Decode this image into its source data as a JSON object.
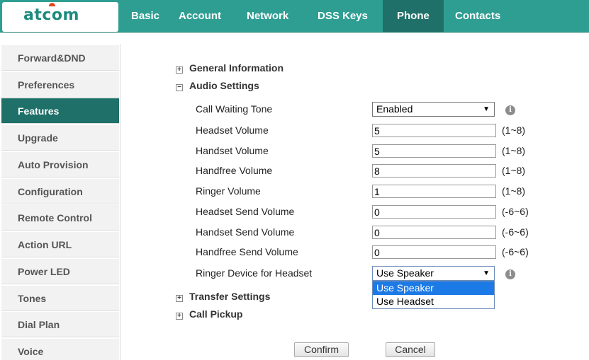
{
  "brand": {
    "logo": "atcom"
  },
  "nav": {
    "tabs": [
      "Basic",
      "Account",
      "Network",
      "DSS Keys",
      "Phone",
      "Contacts"
    ],
    "active": "Phone"
  },
  "sidebar": {
    "items": [
      "Forward&DND",
      "Preferences",
      "Features",
      "Upgrade",
      "Auto Provision",
      "Configuration",
      "Remote Control",
      "Action URL",
      "Power LED",
      "Tones",
      "Dial Plan",
      "Voice"
    ],
    "active": "Features"
  },
  "sections": {
    "general": {
      "sign": "+",
      "label": "General Information"
    },
    "audio": {
      "sign": "−",
      "label": "Audio Settings"
    },
    "transfer": {
      "sign": "+",
      "label": "Transfer Settings"
    },
    "pickup": {
      "sign": "+",
      "label": "Call Pickup"
    }
  },
  "audio": {
    "call_waiting_tone": {
      "label": "Call Waiting Tone",
      "value": "Enabled"
    },
    "headset_volume": {
      "label": "Headset Volume",
      "value": "5",
      "range": "(1~8)"
    },
    "handset_volume": {
      "label": "Handset Volume",
      "value": "5",
      "range": "(1~8)"
    },
    "handfree_volume": {
      "label": "Handfree Volume",
      "value": "8",
      "range": "(1~8)"
    },
    "ringer_volume": {
      "label": "Ringer Volume",
      "value": "1",
      "range": "(1~8)"
    },
    "headset_send_volume": {
      "label": "Headset Send Volume",
      "value": "0",
      "range": "(-6~6)"
    },
    "handset_send_volume": {
      "label": "Handset Send Volume",
      "value": "0",
      "range": "(-6~6)"
    },
    "handfree_send_volume": {
      "label": "Handfree Send Volume",
      "value": "0",
      "range": "(-6~6)"
    },
    "ringer_device": {
      "label": "Ringer Device for Headset",
      "value": "Use Speaker",
      "options": [
        "Use Speaker",
        "Use Headset"
      ],
      "highlighted": "Use Speaker"
    }
  },
  "icons": {
    "info": "i",
    "dropdown_arrow": "▼"
  },
  "buttons": {
    "confirm": "Confirm",
    "cancel": "Cancel"
  },
  "colors": {
    "header": "#2f9e92",
    "active": "#1e7069",
    "highlight": "#1c7ae6"
  }
}
